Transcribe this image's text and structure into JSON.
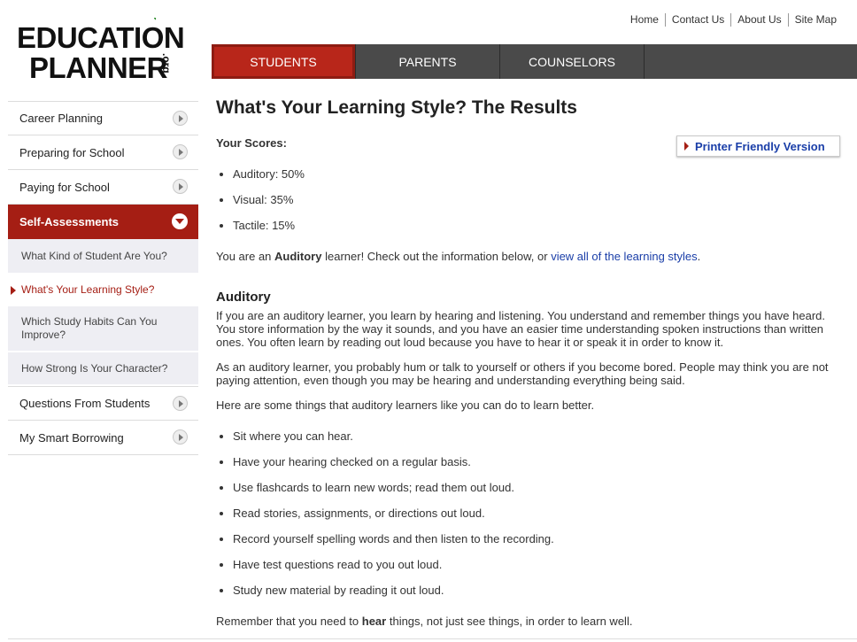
{
  "logo": {
    "line1": "EDUCATION",
    "line2": "PLANNER",
    "suffix": ".org"
  },
  "top_links": [
    "Home",
    "Contact Us",
    "About Us",
    "Site Map"
  ],
  "nav_tabs": [
    {
      "label": "Students",
      "active": true
    },
    {
      "label": "Parents",
      "active": false
    },
    {
      "label": "Counselors",
      "active": false
    }
  ],
  "sidebar": {
    "items": [
      {
        "label": "Career Planning"
      },
      {
        "label": "Preparing for School"
      },
      {
        "label": "Paying for School"
      },
      {
        "label": "Self-Assessments"
      },
      {
        "label": "Questions From Students"
      },
      {
        "label": "My Smart Borrowing"
      }
    ],
    "subitems": [
      {
        "label": "What Kind of Student Are You?"
      },
      {
        "label": "What's Your Learning Style?"
      },
      {
        "label": "Which Study Habits Can You Improve?"
      },
      {
        "label": "How Strong Is Your Character?"
      }
    ]
  },
  "content": {
    "title": "What's Your Learning Style? The Results",
    "scores_label": "Your Scores:",
    "printer_label": "Printer Friendly Version",
    "scores": [
      "Auditory: 50%",
      "Visual: 35%",
      "Tactile: 15%"
    ],
    "learner_pre": "You are an ",
    "learner_bold": "Auditory",
    "learner_mid": " learner! Check out the information below, or ",
    "learner_link": "view all of the learning styles",
    "learner_end": ".",
    "section_heading": "Auditory",
    "para1": "If you are an auditory learner, you learn by hearing and listening. You understand and remember things you have heard. You store information by the way it sounds, and you have an easier time understanding spoken instructions than written ones. You often learn by reading out loud because you have to hear it or speak it in order to know it.",
    "para2": "As an auditory learner, you probably hum or talk to yourself or others if you become bored. People may think you are not paying attention, even though you may be hearing and understanding everything being said.",
    "para3": "Here are some things that auditory learners like you can do to learn better.",
    "tips": [
      "Sit where you can hear.",
      "Have your hearing checked on a regular basis.",
      "Use flashcards to learn new words; read them out loud.",
      "Read stories, assignments, or directions out loud.",
      "Record yourself spelling words and then listen to the recording.",
      "Have test questions read to you out loud.",
      "Study new material by reading it out loud."
    ],
    "final_pre": "Remember that you need to ",
    "final_bold": "hear",
    "final_end": " things, not just see things, in order to learn well."
  },
  "colors": {
    "brand_red": "#a51e14",
    "nav_gray": "#4a4a4a",
    "link_blue": "#1a3ea8"
  }
}
